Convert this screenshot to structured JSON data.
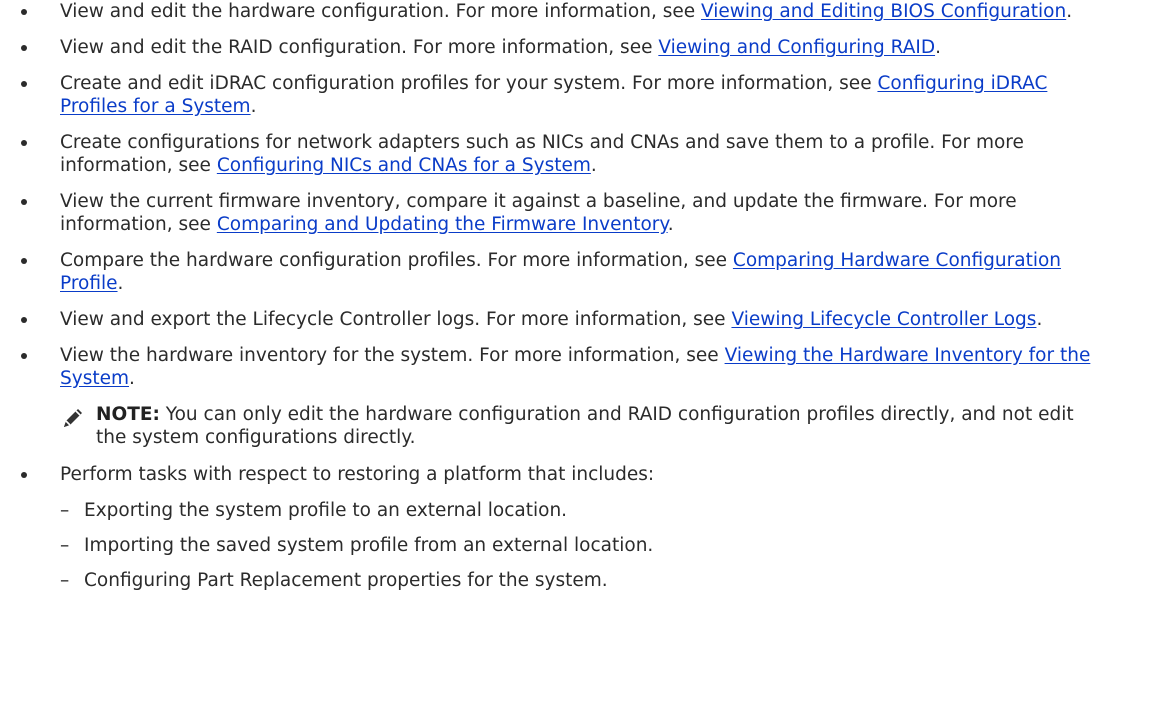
{
  "items": [
    {
      "text": "View and edit the hardware configuration. For more information, see ",
      "link": "Viewing and Editing BIOS Configuration",
      "after": "."
    },
    {
      "text": "View and edit the RAID configuration. For more information, see ",
      "link": "Viewing and Configuring RAID",
      "after": "."
    },
    {
      "text": "Create and edit iDRAC configuration profiles for your system. For more information, see ",
      "link": "Configuring iDRAC Profiles for a System",
      "after": "."
    },
    {
      "text": "Create configurations for network adapters such as NICs and CNAs and save them to a profile. For more information, see ",
      "link": "Configuring NICs and CNAs for a System",
      "after": "."
    },
    {
      "text": "View the current firmware inventory, compare it against a baseline, and update the firmware. For more information, see ",
      "link": "Comparing and Updating the Firmware Inventory",
      "after": "."
    },
    {
      "text": "Compare the hardware configuration profiles. For more information, see ",
      "link": "Comparing Hardware Configuration Profile",
      "after": "."
    },
    {
      "text": "View and export the Lifecycle Controller logs. For more information, see ",
      "link": "Viewing Lifecycle Controller Logs",
      "after": "."
    },
    {
      "text": "View the hardware inventory for the system. For more information, see ",
      "link": "Viewing the Hardware Inventory for the System",
      "after": "."
    }
  ],
  "note": {
    "label": "NOTE:",
    "text": " You can only edit the hardware configuration and RAID configuration profiles directly, and not edit the system configurations directly.",
    "icon": "pencil-icon"
  },
  "restore": {
    "text": "Perform tasks with respect to restoring a platform that includes:",
    "dash": "–",
    "subitems": [
      "Exporting the system profile to an external location.",
      "Importing the saved system profile from an external location.",
      "Configuring Part Replacement properties for the system."
    ]
  }
}
